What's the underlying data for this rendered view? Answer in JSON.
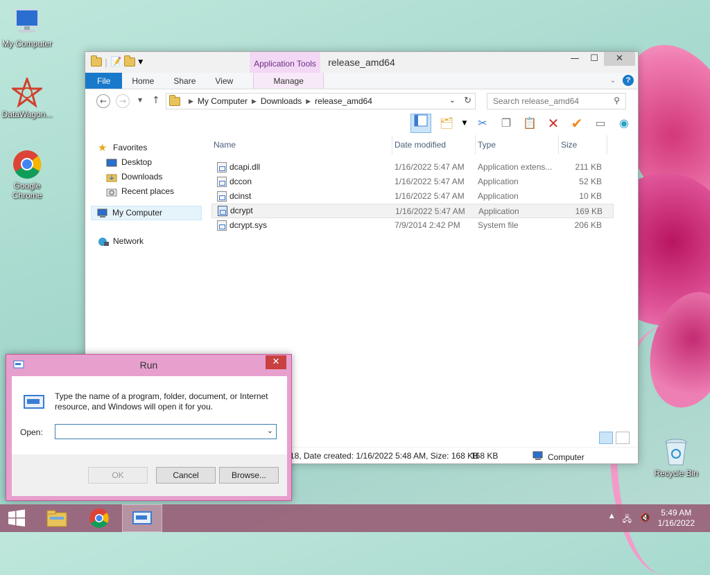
{
  "desktop": {
    "icons": [
      {
        "label": "My Computer"
      },
      {
        "label": "DataWagon..."
      },
      {
        "label": "Google Chrome"
      },
      {
        "label": "Recycle Bin"
      }
    ]
  },
  "explorer": {
    "title": "release_amd64",
    "contextual_tab": "Application Tools",
    "tabs": {
      "file": "File",
      "home": "Home",
      "share": "Share",
      "view": "View",
      "manage": "Manage"
    },
    "help": "?",
    "breadcrumb": [
      "My Computer",
      "Downloads",
      "release_amd64"
    ],
    "search_placeholder": "Search release_amd64",
    "nav": {
      "favorites": "Favorites",
      "desktop": "Desktop",
      "downloads": "Downloads",
      "recent": "Recent places",
      "computer": "My Computer",
      "network": "Network"
    },
    "columns": {
      "name": "Name",
      "date": "Date modified",
      "type": "Type",
      "size": "Size"
    },
    "files": [
      {
        "name": "dcapi.dll",
        "date": "1/16/2022 5:47 AM",
        "type": "Application extens...",
        "size": "211 KB"
      },
      {
        "name": "dccon",
        "date": "1/16/2022 5:47 AM",
        "type": "Application",
        "size": "52 KB"
      },
      {
        "name": "dcinst",
        "date": "1/16/2022 5:47 AM",
        "type": "Application",
        "size": "10 KB"
      },
      {
        "name": "dcrypt",
        "date": "1/16/2022 5:47 AM",
        "type": "Application",
        "size": "169 KB"
      },
      {
        "name": "dcrypt.sys",
        "date": "7/9/2014 2:42 PM",
        "type": "System file",
        "size": "206 KB"
      }
    ],
    "status": {
      "details": "18, Date created: 1/16/2022 5:48 AM, Size: 168 KB",
      "size": "168 KB",
      "location": "Computer"
    }
  },
  "run_dialog": {
    "title": "Run",
    "description": "Type the name of a program, folder, document, or Internet resource, and Windows will open it for you.",
    "open_label": "Open:",
    "open_value": "",
    "ok": "OK",
    "cancel": "Cancel",
    "browse": "Browse..."
  },
  "taskbar": {
    "time": "5:49 AM",
    "date": "1/16/2022"
  },
  "colors": {
    "file_tab": "#1979ca",
    "taskbar": "#986178",
    "run_frame": "#e7a0cd"
  }
}
